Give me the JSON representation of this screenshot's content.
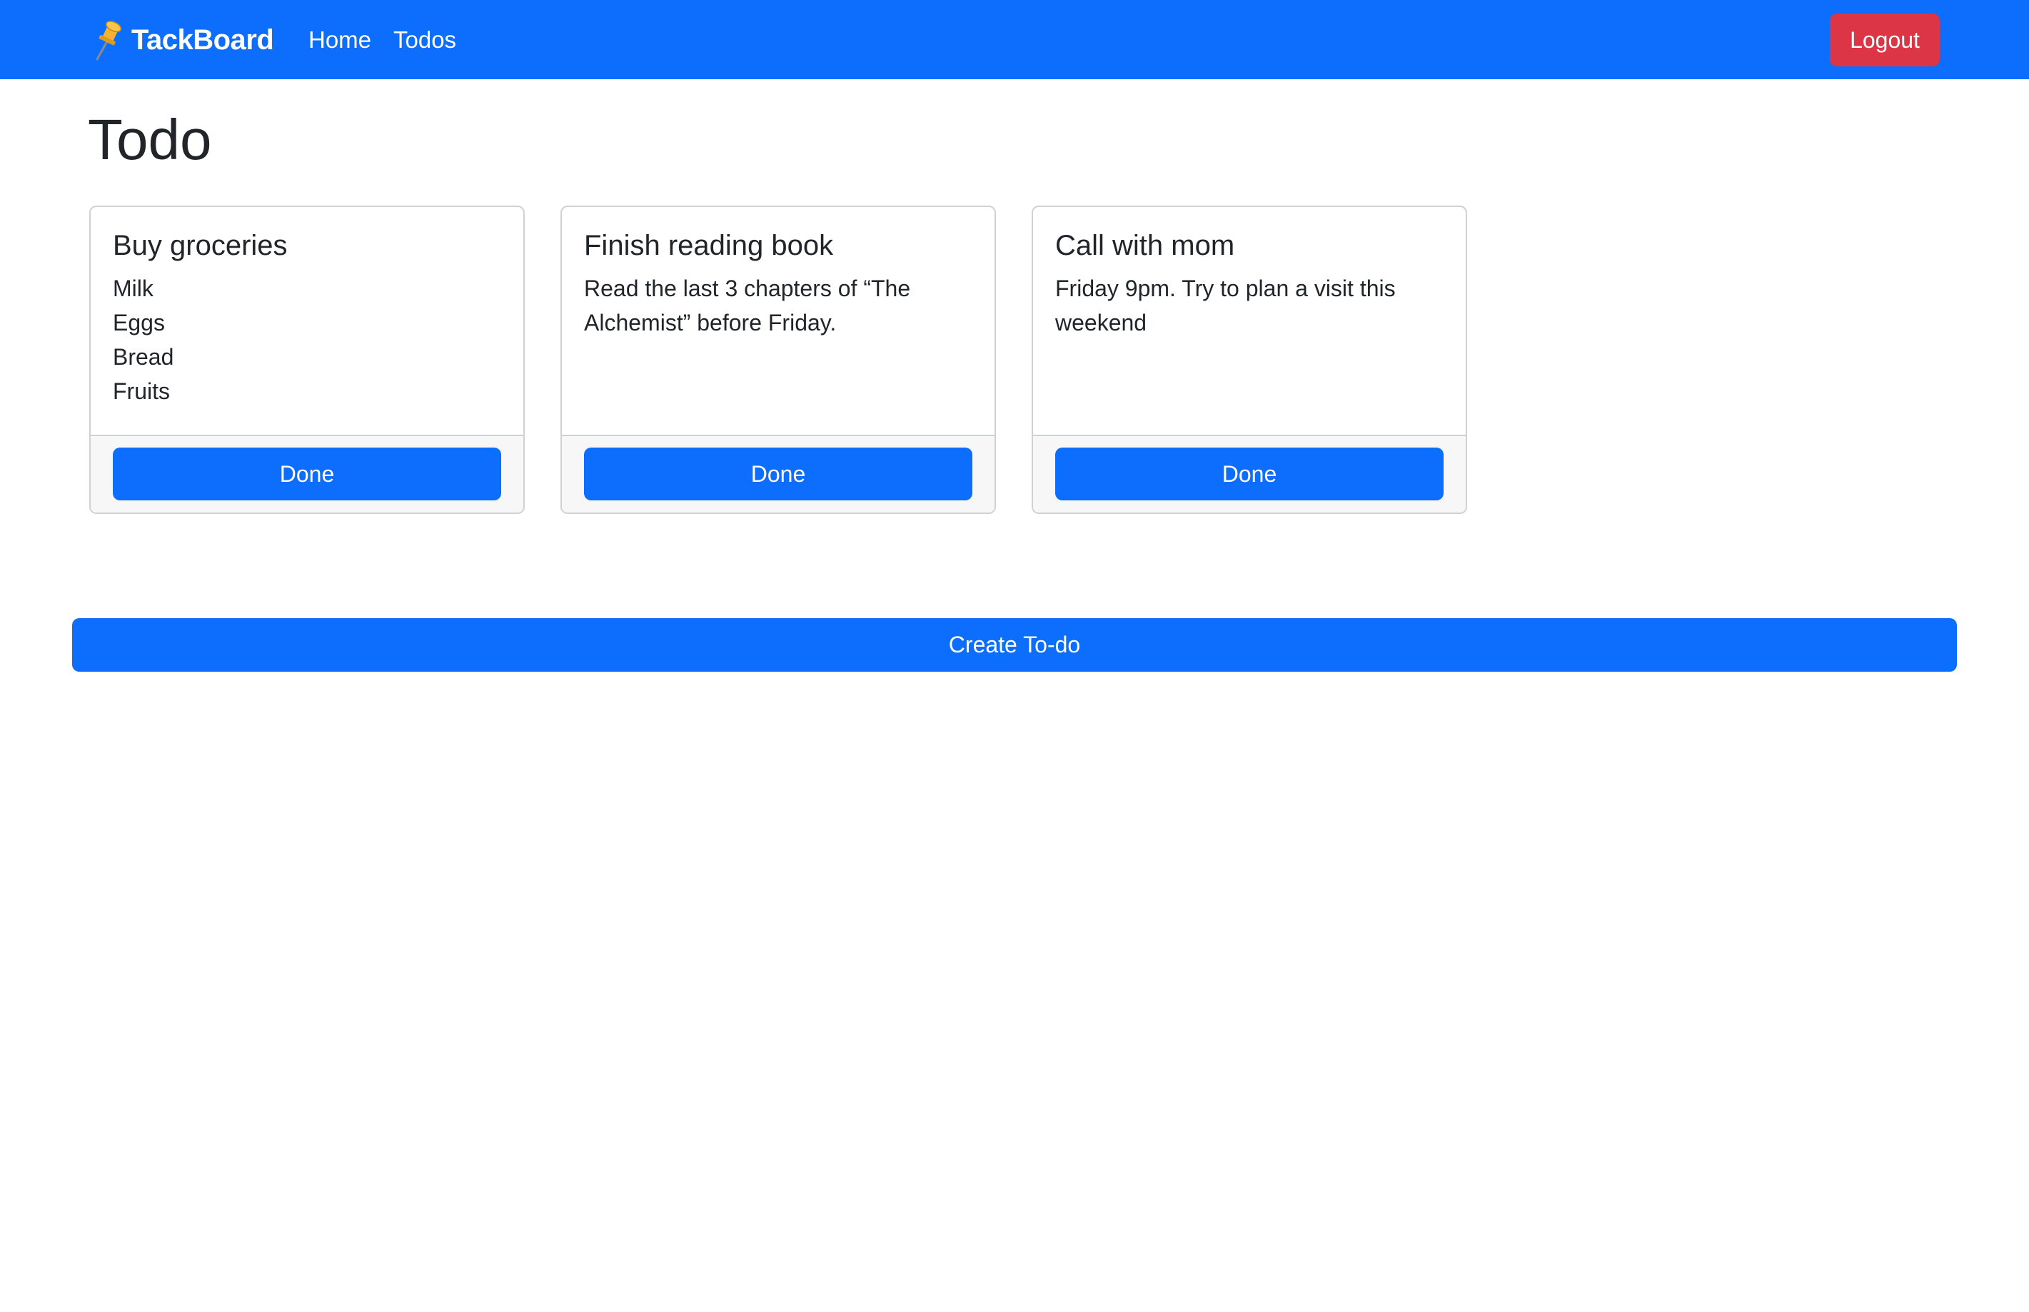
{
  "navbar": {
    "brand": "TackBoard",
    "brand_icon": "pushpin-icon",
    "links": [
      {
        "label": "Home"
      },
      {
        "label": "Todos"
      }
    ],
    "logout_label": "Logout",
    "colors": {
      "primary": "#0d6efd",
      "danger": "#dc3545"
    }
  },
  "page": {
    "title": "Todo"
  },
  "todos": [
    {
      "title": "Buy groceries",
      "text": "Milk\nEggs\nBread\nFruits",
      "button": "Done"
    },
    {
      "title": "Finish reading book",
      "text": "Read the last 3 chapters of “The\nAlchemist” before Friday.",
      "button": "Done"
    },
    {
      "title": "Call with mom",
      "text": "Friday 9pm. Try to plan a visit this\nweekend",
      "button": "Done"
    }
  ],
  "create_button": {
    "label": "Create To-do"
  }
}
